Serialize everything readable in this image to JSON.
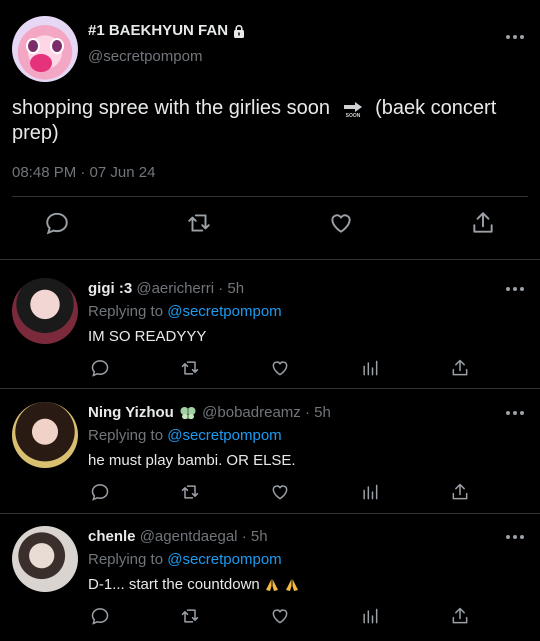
{
  "main_tweet": {
    "display_name": "#1 BAEKHYUN FAN",
    "handle": "@secretpompom",
    "text_before": "shopping spree with the girlies soon",
    "text_after": "(baek concert prep)",
    "emoji": "soon-arrow-icon",
    "timestamp": "08:48 PM · 07 Jun 24"
  },
  "replies": [
    {
      "name": "gigi :3",
      "handle": "@aericherri",
      "age": "· 5h",
      "replying_label": "Replying to",
      "replying_to": "@secretpompom",
      "text": "IM SO READYYY"
    },
    {
      "name": "Ning Yizhou",
      "handle": "@bobadreamz",
      "age": "· 5h",
      "replying_label": "Replying to",
      "replying_to": "@secretpompom",
      "text": "he must play bambi. OR ELSE."
    },
    {
      "name": "chenle",
      "handle": "@agentdaegal",
      "age": "· 5h",
      "replying_label": "Replying to",
      "replying_to": "@secretpompom",
      "text": "D-1... start the countdown"
    }
  ],
  "colors": {
    "background": "#000000",
    "text": "#e7e9ea",
    "muted": "#71767b",
    "link": "#1d9bf0",
    "divider": "#2f3336",
    "icon": "#9aa0a6"
  }
}
